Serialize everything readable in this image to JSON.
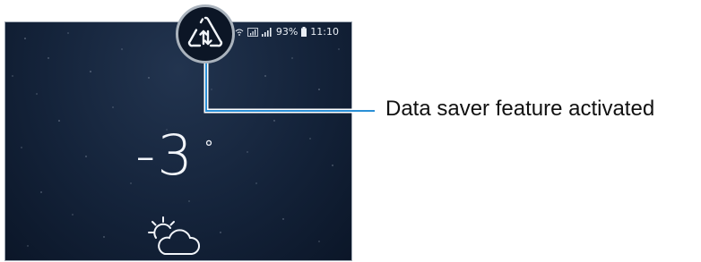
{
  "status_bar": {
    "battery_percent": "93%",
    "time": "11:10"
  },
  "weather": {
    "temperature": "-3",
    "degree_symbol": "°",
    "condition_icon": "partly-cloudy-icon"
  },
  "callout": {
    "icon": "data-saver-icon",
    "label": "Data saver feature activated"
  },
  "colors": {
    "screen_background": "#14233a",
    "leader_line": "#2a8fd6",
    "callout_border": "#aab3bd"
  }
}
